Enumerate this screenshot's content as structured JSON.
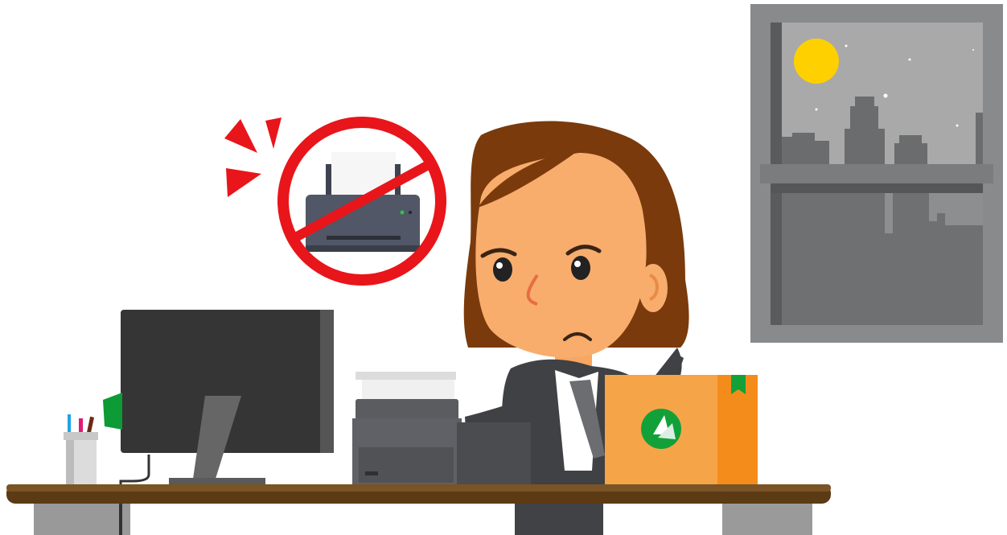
{
  "colors": {
    "background": "#ffffff",
    "prohibition_red": "#e8151b",
    "printer_body": "#515766",
    "hair": "#7a3a0c",
    "skin": "#f8ad6d",
    "suit": "#3f4144",
    "box_orange": "#f6a448",
    "logo_green": "#12a139",
    "desk_top": "#5b3a14",
    "window_frame": "#8a8a8a",
    "sun": "#ffd000"
  },
  "icons": {
    "prohibition": "no-printing-icon",
    "alert_marks": "alert-burst-icon",
    "box_logo": "leaf-logo-icon"
  }
}
